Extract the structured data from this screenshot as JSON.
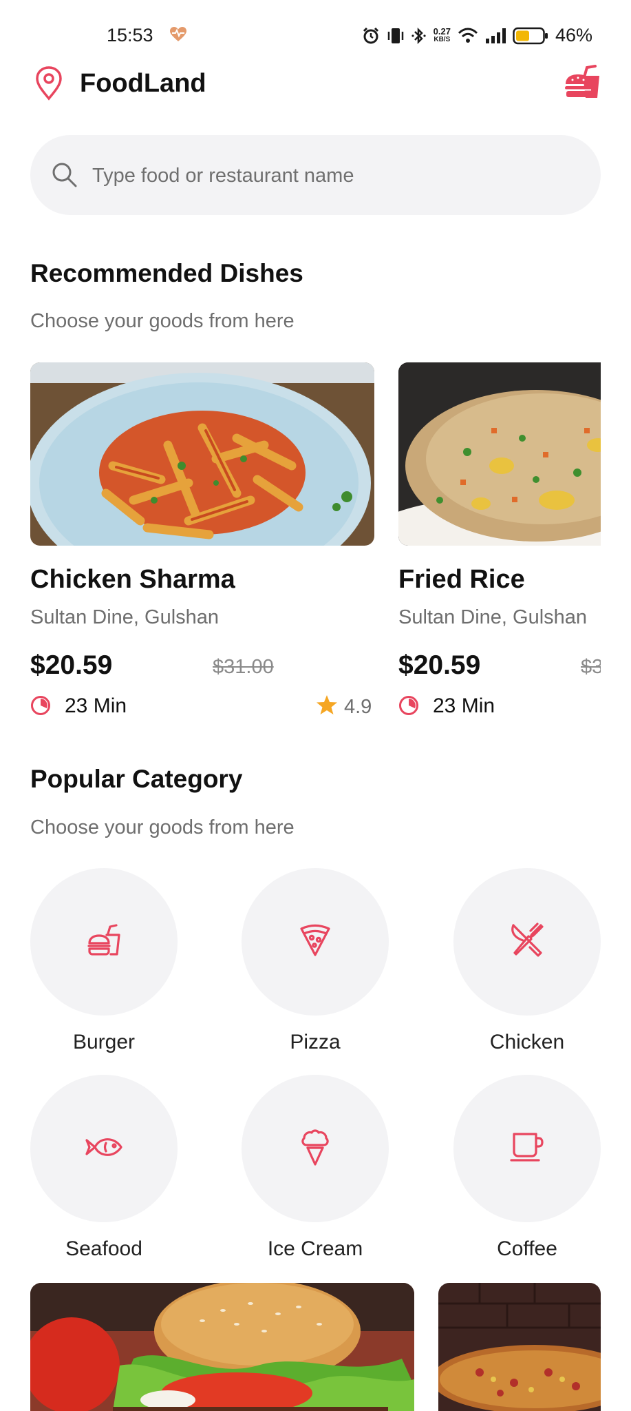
{
  "status_bar": {
    "time": "15:53",
    "net_speed_value": "0.27",
    "net_speed_unit": "KB/S",
    "battery": "46%"
  },
  "header": {
    "title": "FoodLand"
  },
  "search": {
    "placeholder": "Type food or restaurant name"
  },
  "recommended": {
    "title": "Recommended Dishes",
    "subtitle": "Choose your goods from here",
    "dishes": [
      {
        "name": "Chicken Sharma",
        "restaurant": "Sultan Dine, Gulshan",
        "price": "$20.59",
        "old_price": "$31.00",
        "time": "23 Min",
        "rating": "4.9"
      },
      {
        "name": "Fried Rice",
        "restaurant": "Sultan Dine, Gulshan",
        "price": "$20.59",
        "old_price": "$3",
        "time": "23 Min"
      }
    ]
  },
  "popular": {
    "title": "Popular Category",
    "subtitle": "Choose your goods from here",
    "categories": [
      {
        "label": "Burger",
        "icon": "burger-icon"
      },
      {
        "label": "Pizza",
        "icon": "pizza-icon"
      },
      {
        "label": "Chicken",
        "icon": "cutlery-icon"
      },
      {
        "label": "Seafood",
        "icon": "fish-icon"
      },
      {
        "label": "Ice Cream",
        "icon": "ice-cream-icon"
      },
      {
        "label": "Coffee",
        "icon": "coffee-icon"
      }
    ]
  },
  "colors": {
    "accent": "#e8455e",
    "surface": "#f3f3f5",
    "star": "#f5a623",
    "muted": "#6e6e6e"
  }
}
